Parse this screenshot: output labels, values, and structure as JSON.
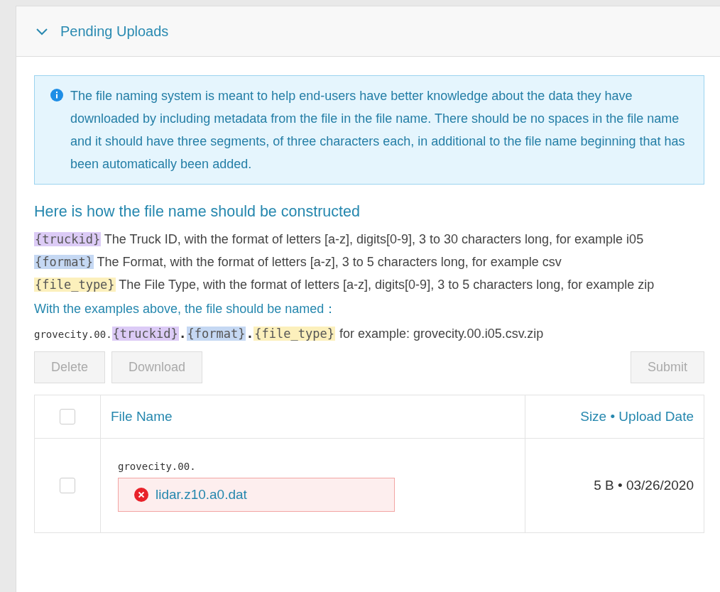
{
  "panel": {
    "title": "Pending Uploads",
    "expanded": true
  },
  "info": {
    "text": "The file naming system is meant to help end-users have better knowledge about the data they have downloaded by including metadata from the file in the file name. There should be no spaces in the file name and it should have three segments, of three characters each, in additional to the file name beginning that has been automatically been added."
  },
  "heading": "Here is how the file name should be constructed",
  "definitions": [
    {
      "token": "{truckid}",
      "color": "#dccbf6",
      "text": "The Truck ID, with the format of letters [a-z], digits[0-9], 3 to 30 characters long, for example i05"
    },
    {
      "token": "{format}",
      "color": "#c5d8f3",
      "text": "The Format, with the format of letters [a-z], 3 to 5 characters long, for example csv"
    },
    {
      "token": "{file_type}",
      "color": "#fcf0bc",
      "text": "The File Type, with the format of letters [a-z], digits[0-9], 3 to 5 characters long, for example zip"
    }
  ],
  "example_heading": "With the examples above, the file should be named：",
  "pattern": [
    {
      "kind": "plain",
      "text": "grovecity.00."
    },
    {
      "kind": "token",
      "text": "{truckid}",
      "color": "#dccbf6"
    },
    {
      "kind": "plain",
      "text": "."
    },
    {
      "kind": "token",
      "text": "{format}",
      "color": "#c5d8f3"
    },
    {
      "kind": "plain",
      "text": "."
    },
    {
      "kind": "token",
      "text": "{file_type}",
      "color": "#fcf0bc"
    },
    {
      "kind": "note",
      "text": "for example: grovecity.00.i05.csv.zip"
    }
  ],
  "toolbar": {
    "left": [
      {
        "label": "Delete",
        "disabled": true
      },
      {
        "label": "Download",
        "disabled": true
      }
    ],
    "right": [
      {
        "label": "Submit",
        "disabled": true
      }
    ]
  },
  "table": {
    "select_all": {
      "checked": false
    },
    "columns": [
      "File Name",
      "Size • Upload Date"
    ],
    "rows": [
      {
        "checked": false,
        "prefix": "grovecity.00.",
        "file_name": "lidar.z10.a0.dat",
        "error": true,
        "size_date": "5 B • 03/26/2020"
      }
    ]
  }
}
